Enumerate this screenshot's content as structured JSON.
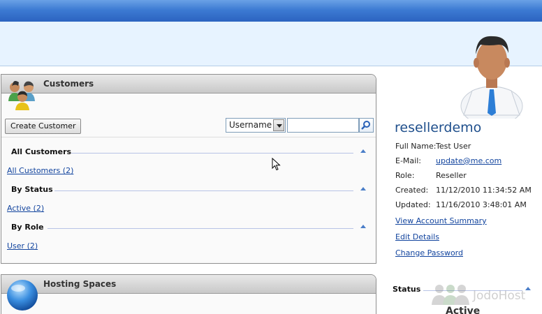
{
  "customers_panel": {
    "title": "Customers",
    "create_button": "Create Customer",
    "search_field_select": "Username",
    "search_value": "",
    "groups": [
      {
        "heading": "All Customers",
        "link": "All Customers (2)"
      },
      {
        "heading": "By Status",
        "link": "Active (2)"
      },
      {
        "heading": "By Role",
        "link": "User (2)"
      }
    ]
  },
  "hosting_panel": {
    "title": "Hosting Spaces"
  },
  "user": {
    "username": "resellerdemo",
    "fields": [
      {
        "key": "Full Name:",
        "value": "Test User"
      },
      {
        "key": "E-Mail:",
        "value": "update@me.com"
      },
      {
        "key": "Role:",
        "value": "Reseller"
      },
      {
        "key": "Created:",
        "value": "11/12/2010 11:34:52 AM"
      },
      {
        "key": "Updated:",
        "value": "11/16/2010 3:48:01 AM"
      }
    ],
    "links": [
      "View Account Summary",
      "Edit Details",
      "Change Password"
    ]
  },
  "status_section": {
    "heading": "Status",
    "value": "Active"
  },
  "watermark": "JodoHost",
  "colors": {
    "header_blue": "#3d7bd3",
    "header_band": "#e7f3ff",
    "link": "#12449e",
    "username": "#1f4f8c"
  }
}
